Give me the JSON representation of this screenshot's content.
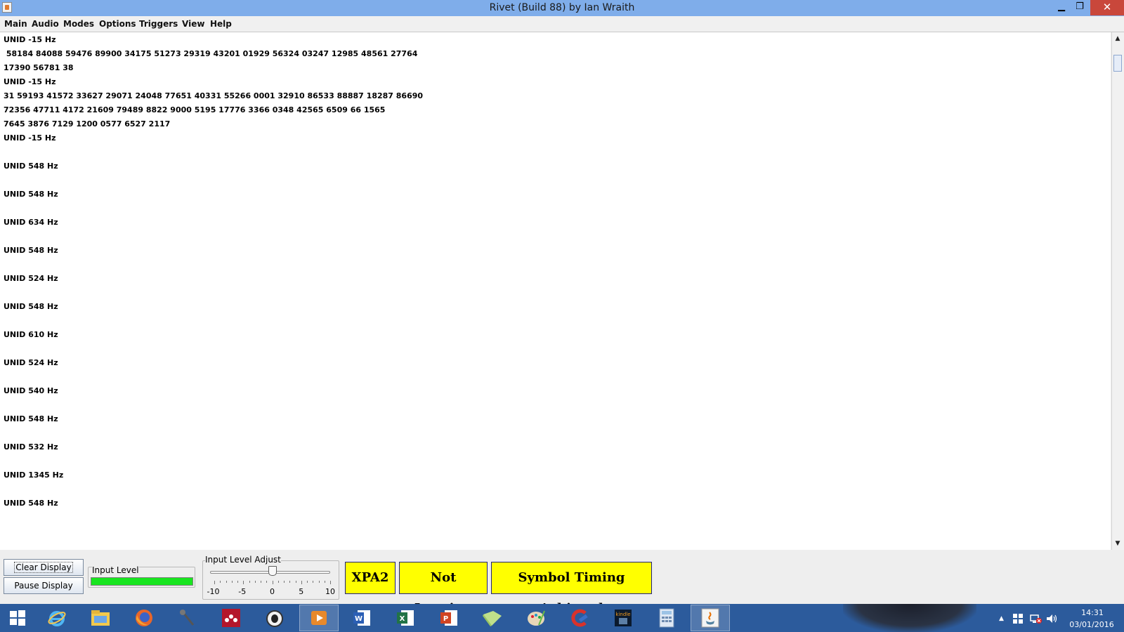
{
  "window": {
    "title": "Rivet (Build 88) by Ian Wraith",
    "minimize_glyph": "▁",
    "maximize_glyph": "❐",
    "close_glyph": "✕"
  },
  "menu": [
    "Main",
    "Audio",
    "Modes",
    "Options",
    "Triggers",
    "View",
    "Help"
  ],
  "display_lines": [
    "UNID -15 Hz",
    " 58184 84088 59476 89900 34175 51273 29319 43201 01929 56324 03247 12985 48561 27764",
    "17390 56781 38",
    "UNID -15 Hz",
    "31 59193 41572 33627 29071 24048 77651 40331 55266 0001 32910 86533 88887 18287 86690",
    "72356 47711 4172 21609 79489 8822 9000 5195 17776 3366 0348 42565 6509 66 1565",
    "7645 3876 7129 1200 0577 6527 2117",
    "UNID -15 Hz",
    "",
    "UNID 548 Hz",
    "",
    "UNID 548 Hz",
    "",
    "UNID 634 Hz",
    "",
    "UNID 548 Hz",
    "",
    "UNID 524 Hz",
    "",
    "UNID 548 Hz",
    "",
    "UNID 610 Hz",
    "",
    "UNID 524 Hz",
    "",
    "UNID 540 Hz",
    "",
    "UNID 548 Hz",
    "",
    "UNID 532 Hz",
    "",
    "UNID 1345 Hz",
    "",
    "UNID 548 Hz"
  ],
  "controls": {
    "clear_label": "Clear Display",
    "pause_label": "Pause Display",
    "input_level_label": "Input Level",
    "input_level_fraction": 1.0,
    "adjust_label": "Input Level Adjust",
    "slider": {
      "min": -10,
      "max": 10,
      "value": 0,
      "labels": [
        "-10",
        "-5",
        "0",
        "5",
        "10"
      ]
    }
  },
  "status": {
    "mode": "XPA2",
    "logging": "Not Logging",
    "timing": "Symbol Timing Achieved",
    "color": "#ffff00"
  },
  "taskbar": {
    "icons": [
      "windows-start-icon",
      "internet-explorer-icon",
      "file-explorer-icon",
      "firefox-icon",
      "microphone-icon",
      "mendeley-icon",
      "sheep-icon",
      "media-player-icon",
      "word-icon",
      "excel-icon",
      "powerpoint-icon",
      "folder-note-icon",
      "paint-icon",
      "ccleaner-icon",
      "kindle-icon",
      "calculator-icon",
      "java-icon"
    ],
    "time": "14:31",
    "date": "03/01/2016"
  }
}
